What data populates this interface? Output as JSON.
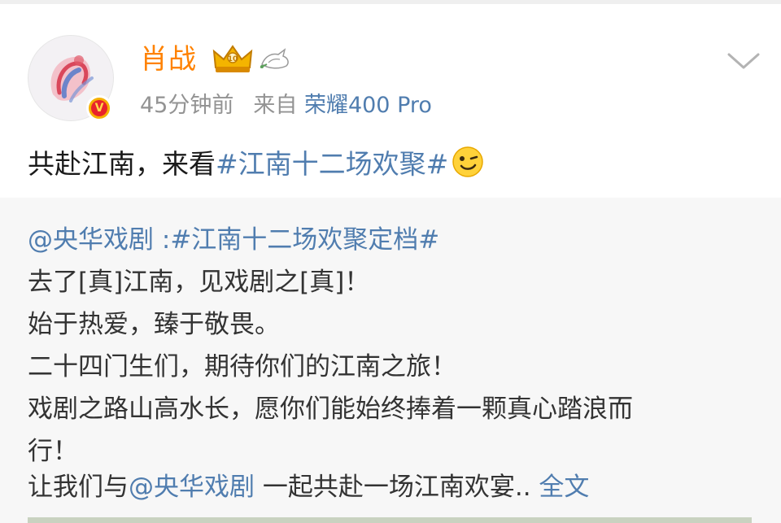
{
  "post": {
    "username": "肖战",
    "time": "45分钟前",
    "source_prefix": "来自",
    "source_device": "荣耀400 Pro",
    "text_plain": "共赴江南，来看",
    "text_tag": "#江南十二场欢聚#",
    "icons": {
      "avatar": "avatar",
      "verified": "verified-badge-icon",
      "crown": "crown-badge-icon",
      "dove": "dove-icon",
      "menu": "chevron-down-icon",
      "emoji": "wink-emoji-icon"
    }
  },
  "repost": {
    "author": "@央华戏剧",
    "author_sep": " :",
    "tag": "#江南十二场欢聚定档#",
    "lines": [
      "去了[真]江南，见戏剧之[真]！",
      "始于热爱，臻于敬畏。",
      "二十四门生们，期待你们的江南之旅！",
      "戏剧之路山高水长，愿你们能始终捧着一颗真心踏浪而",
      "行！"
    ],
    "last_line_prefix": "让我们与",
    "last_line_mention": "@央华戏剧",
    "last_line_suffix": " 一起共赴一场江南欢宴.. ",
    "full_text_link": "全文"
  },
  "colors": {
    "username": "#ff8200",
    "link": "#507daf",
    "meta": "#939393",
    "repost_bg": "#f7f7f7"
  }
}
